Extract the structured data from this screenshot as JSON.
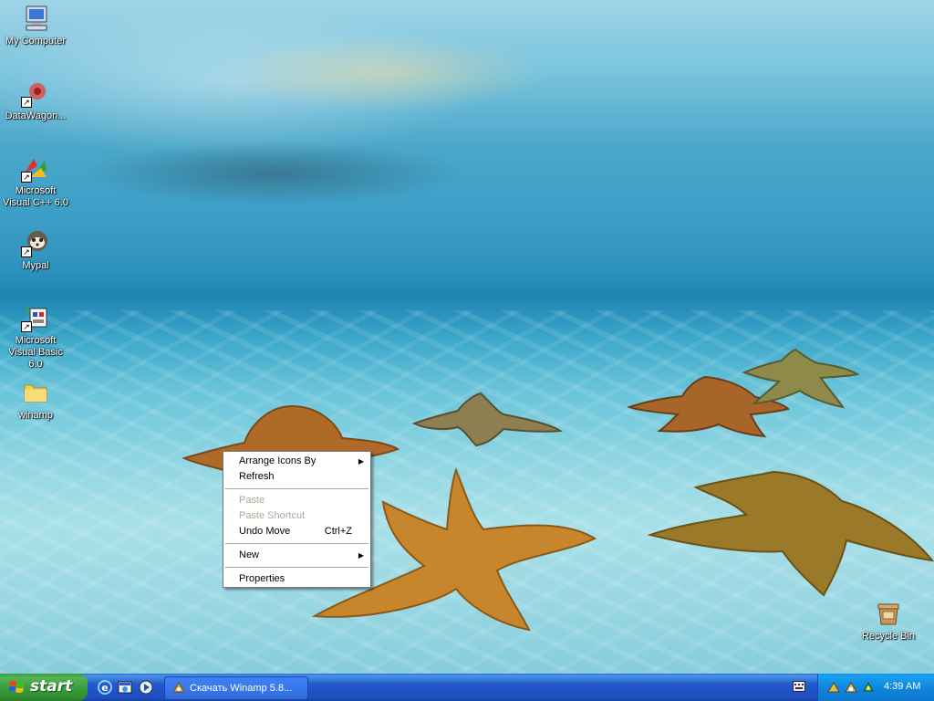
{
  "desktop": {
    "icons": [
      {
        "label": "My Computer",
        "icon": "my-computer-icon"
      },
      {
        "label": "DataWagon...",
        "icon": "datawagon-icon"
      },
      {
        "label": "Microsoft Visual C++ 6.0",
        "icon": "visual-cpp-icon"
      },
      {
        "label": "Mypal",
        "icon": "mypal-icon"
      },
      {
        "label": "Microsoft Visual Basic 6.0",
        "icon": "visual-basic-icon"
      },
      {
        "label": "winamp",
        "icon": "folder-icon"
      },
      {
        "label": "Recycle Bin",
        "icon": "recycle-bin-icon"
      }
    ]
  },
  "context_menu": {
    "arrange_icons_by": "Arrange Icons By",
    "refresh": "Refresh",
    "paste": "Paste",
    "paste_shortcut": "Paste Shortcut",
    "undo_move": "Undo Move",
    "undo_move_shortcut": "Ctrl+Z",
    "new": "New",
    "properties": "Properties"
  },
  "taskbar": {
    "start_label": "start",
    "quick_launch": [
      "internet-explorer-icon",
      "show-desktop-icon",
      "media-player-icon"
    ],
    "task_button_label": "Скачать Winamp 5.8...",
    "tray_icons": [
      "tray-icon-1",
      "tray-icon-2",
      "tray-icon-3"
    ],
    "clock": "4:39 AM"
  },
  "colors": {
    "taskbar_blue": "#245edb",
    "start_green": "#3c9e3c",
    "tray_blue": "#0f87dd",
    "menu_disabled": "#aca899"
  }
}
